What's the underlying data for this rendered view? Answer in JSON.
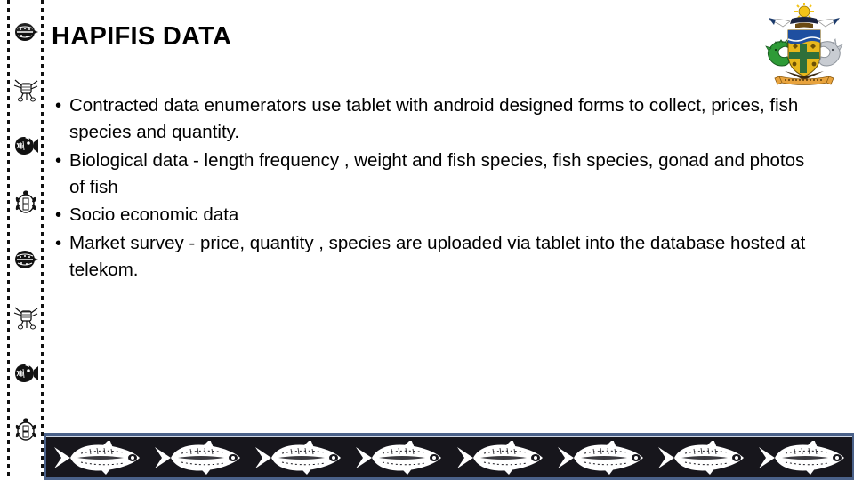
{
  "slide": {
    "title": "HAPIFIS DATA",
    "background_color": "#ffffff",
    "text_color": "#000000"
  },
  "bullets": [
    {
      "marker": "•",
      "text": "Contracted data enumerators  use tablet with android designed forms  to collect, prices, fish species  and quantity."
    },
    {
      "marker": "•",
      "text": "Biological data -  length frequency , weight and  fish species, fish species, gonad and photos of fish"
    },
    {
      "marker": "•",
      "text": "Socio economic data"
    },
    {
      "marker": "•",
      "text": "Market survey  - price, quantity , species  are uploaded via tablet into the database hosted at telekom."
    }
  ],
  "decor": {
    "left_strip": {
      "name": "marine-motif-border",
      "motifs": [
        "shell-motif",
        "crab-motif",
        "fish-motif",
        "turtle-motif",
        "shell-motif",
        "crab-motif",
        "fish-motif",
        "turtle-motif"
      ],
      "border_color": "#111111"
    },
    "coat_of_arms": {
      "name": "solomon-islands-coat-of-arms",
      "crocodile_color": "#2e9b37",
      "shark_color": "#c8ccd2",
      "shield_color": "#e8b81d",
      "shield_blue": "#1f4fa0",
      "sun_color": "#f5c518",
      "scroll_color": "#e8a33d"
    },
    "fish_banner": {
      "name": "fish-strip-banner",
      "frame_color": "#4a6189",
      "background_color": "#17161c",
      "fish_color": "#ffffff",
      "fish_count": 8
    }
  }
}
